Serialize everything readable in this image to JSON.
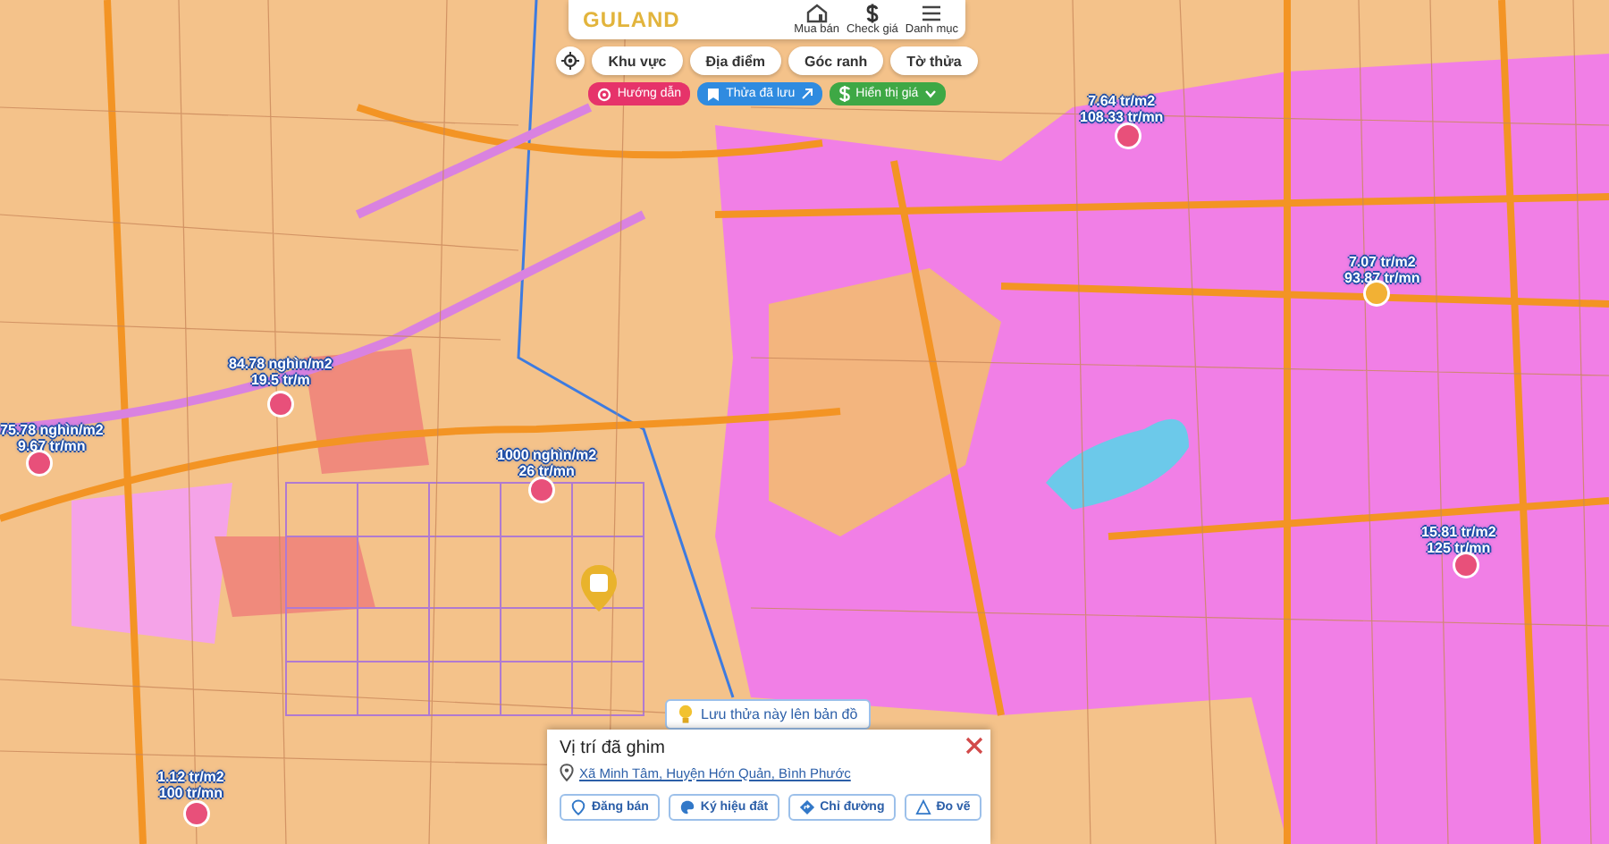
{
  "app": {
    "logo": "GULAND",
    "nav": [
      {
        "label": "Mua bán"
      },
      {
        "label": "Check giá"
      },
      {
        "label": "Danh mục"
      }
    ]
  },
  "filters": [
    "Khu vực",
    "Địa điểm",
    "Góc ranh",
    "Tờ thửa"
  ],
  "actions": [
    {
      "label": "Hướng dẫn",
      "kind": "guide"
    },
    {
      "label": "Thửa đã lưu",
      "kind": "saved"
    },
    {
      "label": "Hiển thị giá",
      "kind": "price"
    }
  ],
  "price_pins": [
    {
      "lines": [
        "7.64 tr/m2",
        "108.33 tr/mn"
      ],
      "color": "#e8507a"
    },
    {
      "lines": [
        "7.07 tr/m2",
        "93.87 tr/mn"
      ],
      "color": "#f2b134"
    },
    {
      "lines": [
        "15.81 tr/m2",
        "125 tr/mn"
      ],
      "color": "#e8507a"
    },
    {
      "lines": [
        "1000 nghìn/m2",
        "26 tr/mn"
      ],
      "color": "#e8507a"
    },
    {
      "lines": [
        "84.78 nghìn/m2",
        "19.5 tr/m"
      ],
      "color": "#e8507a"
    },
    {
      "lines": [
        "75.78 nghìn/m2",
        "9.67 tr/mn"
      ],
      "color": "#e8507a"
    },
    {
      "lines": [
        "1.12 tr/m2",
        "100 tr/mn"
      ],
      "color": "#e8507a"
    }
  ],
  "save_hint": "Lưu thửa này lên bản đồ",
  "popup": {
    "title": "Vị trí đã ghim",
    "address": "Xã Minh Tâm, Huyện Hớn Quản, Bình Phước",
    "buttons": [
      {
        "label": "Đăng bán"
      },
      {
        "label": "Ký hiệu đất"
      },
      {
        "label": "Chỉ đường"
      },
      {
        "label": "Đo vẽ"
      }
    ]
  }
}
